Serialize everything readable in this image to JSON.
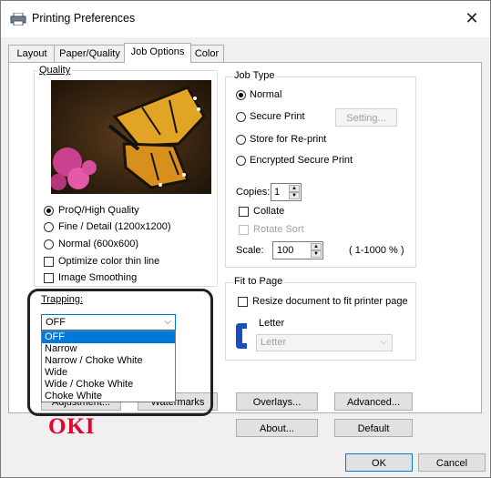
{
  "window": {
    "title": "Printing Preferences",
    "close_glyph": "✕"
  },
  "tabs": [
    {
      "label": "Layout"
    },
    {
      "label": "Paper/Quality"
    },
    {
      "label": "Job Options"
    },
    {
      "label": "Color"
    }
  ],
  "active_tab": "Job Options",
  "quality": {
    "label": "Quality",
    "radios": [
      {
        "label": "ProQ/High Quality",
        "checked": true
      },
      {
        "label": "Fine / Detail (1200x1200)",
        "checked": false
      },
      {
        "label": "Normal (600x600)",
        "checked": false
      }
    ],
    "checkboxes": [
      {
        "label": "Optimize color thin line",
        "checked": false
      },
      {
        "label": "Image Smoothing",
        "checked": false
      }
    ]
  },
  "trapping": {
    "label": "Trapping:",
    "selected": "OFF",
    "options": [
      "OFF",
      "Narrow",
      "Narrow / Choke White",
      "Wide",
      "Wide / Choke White",
      "Choke White"
    ]
  },
  "job_type": {
    "label": "Job Type",
    "radios": [
      {
        "label": "Normal",
        "checked": true
      },
      {
        "label": "Secure Print",
        "checked": false
      },
      {
        "label": "Store for Re-print",
        "checked": false
      },
      {
        "label": "Encrypted Secure Print",
        "checked": false
      }
    ],
    "setting_button": "Setting...",
    "copies_label": "Copies:",
    "copies_value": "1",
    "collate_label": "Collate",
    "rotate_sort_label": "Rotate Sort",
    "scale_label": "Scale:",
    "scale_value": "100",
    "scale_range": "( 1-1000 % )"
  },
  "fit_to_page": {
    "label": "Fit to Page",
    "checkbox_label": "Resize document to fit printer page",
    "letter_label": "Letter",
    "letter_select": "Letter"
  },
  "buttons": {
    "adjustment": "Adjustment...",
    "watermarks": "Watermarks",
    "overlays": "Overlays...",
    "advanced": "Advanced...",
    "about": "About...",
    "default": "Default",
    "ok": "OK",
    "cancel": "Cancel"
  },
  "brand": {
    "logo_text": "OKI",
    "color": "#e4032e"
  },
  "colors": {
    "accent": "#0078d7",
    "highlight_border": "#222222"
  }
}
